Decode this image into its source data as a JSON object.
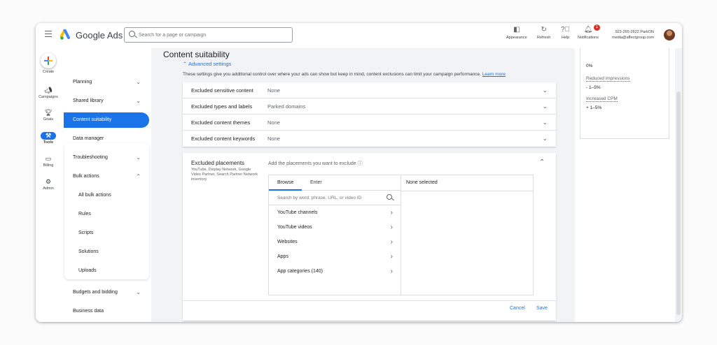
{
  "header": {
    "product": "Google Ads",
    "search_placeholder": "Search for a page or campaign",
    "buttons": [
      {
        "label": "Appearance",
        "icon": "appearance-icon"
      },
      {
        "label": "Refresh",
        "icon": "refresh-icon"
      },
      {
        "label": "Help",
        "icon": "help-icon"
      },
      {
        "label": "Notifications",
        "icon": "bell-icon",
        "badge": "1"
      }
    ],
    "account_id": "923-265-2622 ParkON",
    "account_email": "media@affectgroup.com"
  },
  "rail": {
    "create": "Create",
    "items": [
      {
        "label": "Campaigns",
        "icon": "megaphone-icon"
      },
      {
        "label": "Goals",
        "icon": "trophy-icon"
      },
      {
        "label": "Tools",
        "icon": "tools-icon"
      },
      {
        "label": "Billing",
        "icon": "credit-card-icon"
      },
      {
        "label": "Admin",
        "icon": "gear-icon"
      }
    ]
  },
  "nav": {
    "items": [
      "Planning",
      "Shared library",
      "Content suitability",
      "Data manager",
      "Troubleshooting",
      "Bulk actions",
      "All bulk actions",
      "Rules",
      "Scripts",
      "Solutions",
      "Uploads",
      "Budgets and bidding",
      "Business data"
    ]
  },
  "main": {
    "title": "Content suitability",
    "advanced": "Advanced settings",
    "description": "These settings give you additional control over where your ads can show but keep in mind, content exclusions can limit your campaign performance.",
    "learn_more": "Learn more",
    "rows": [
      {
        "label": "Excluded sensitive content",
        "value": "None"
      },
      {
        "label": "Excluded types and labels",
        "value": "Parked domains"
      },
      {
        "label": "Excluded content themes",
        "value": "None"
      },
      {
        "label": "Excluded content keywords",
        "value": "None"
      }
    ],
    "placements": {
      "title": "Excluded placements",
      "subtitle": "YouTube, Display Network, Google Video Partner, Search Partner Network inventory",
      "prompt": "Add the placements you want to exclude",
      "tabs": [
        "Browse",
        "Enter"
      ],
      "search_placeholder": "Search by word, phrase, URL, or video ID",
      "items": [
        "YouTube channels",
        "YouTube videos",
        "Websites",
        "Apps",
        "App categories (140)"
      ],
      "selected_header": "None selected",
      "cancel": "Cancel",
      "save": "Save"
    }
  },
  "estimates": {
    "top_value": "0%",
    "items": [
      {
        "label": "Reduced impressions",
        "value": "- 1–5%"
      },
      {
        "label": "Increased CPM",
        "value": "+ 1–5%"
      }
    ]
  }
}
